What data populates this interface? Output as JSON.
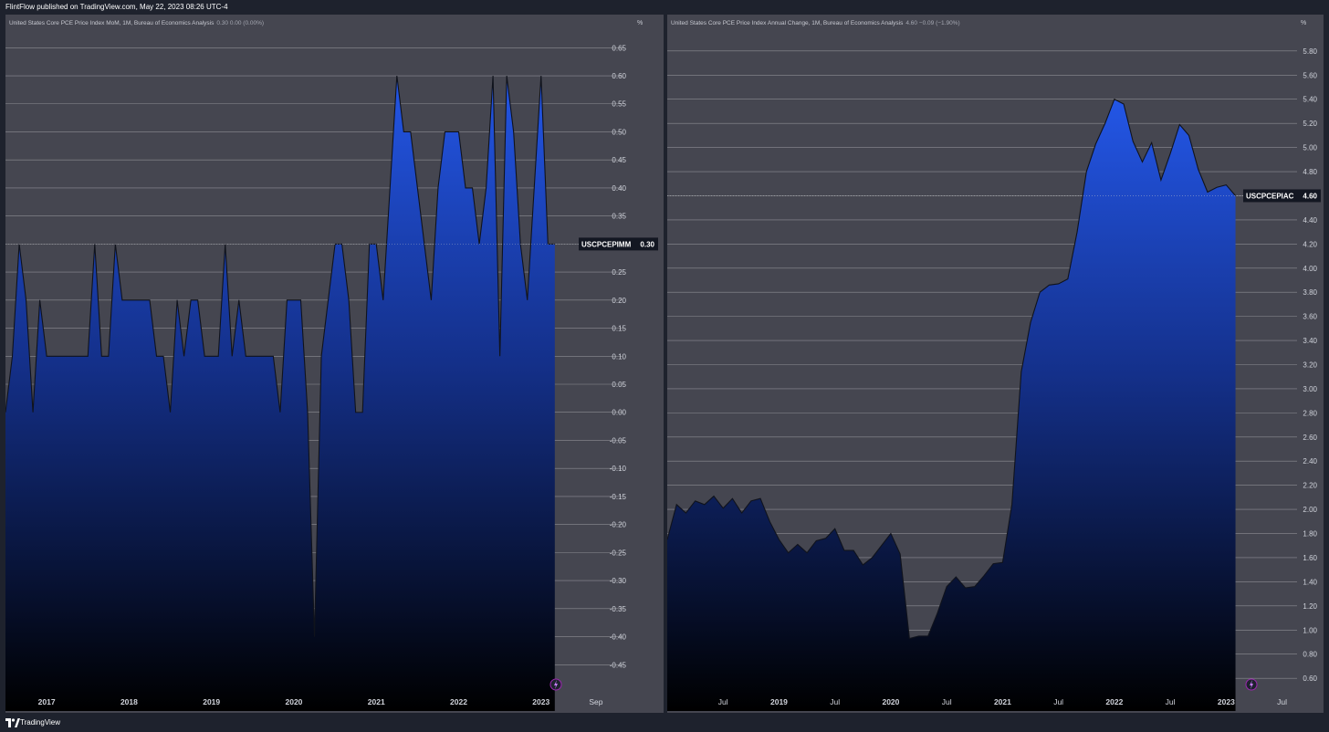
{
  "header": {
    "published": "FlintFlow published on TradingView.com, May 22, 2023 08:26 UTC-4"
  },
  "footer": {
    "brand": "TradingView"
  },
  "colors": {
    "panel_bg": "#454650",
    "page_bg": "#1e222d",
    "area_top": "#2356e6",
    "area_bottom": "#000000",
    "line": "#10131c",
    "grid": "#c8c9cc"
  },
  "icons": {
    "lightning": "lightning-icon",
    "logo": "tradingview-logo-icon"
  },
  "unit": "%",
  "chart_data": [
    {
      "type": "area",
      "legend": "United States Core PCE Price Index MoM, 1M, Bureau of Economics Analysis",
      "legend_values": "0.30  0.00 (0.00%)",
      "symbol": "USCPCEPIMM",
      "last_value_label": "0.30",
      "last_value": 0.3,
      "ylim": [
        -0.5,
        0.67
      ],
      "yticks": [
        0.65,
        0.6,
        0.55,
        0.5,
        0.45,
        0.4,
        0.35,
        0.3,
        0.25,
        0.2,
        0.15,
        0.1,
        0.05,
        0.0,
        -0.05,
        -0.1,
        -0.15,
        -0.2,
        -0.25,
        -0.3,
        -0.35,
        -0.4,
        -0.45
      ],
      "ytick_labels": [
        "0.65",
        "0.60",
        "0.55",
        "0.50",
        "0.45",
        "0.40",
        "0.35",
        "0.30",
        "0.25",
        "0.20",
        "0.15",
        "0.10",
        "0.05",
        "0.00",
        "-0.05",
        "-0.10",
        "-0.15",
        "-0.20",
        "-0.25",
        "-0.30",
        "-0.35",
        "-0.40",
        "-0.45"
      ],
      "x_start": "2016-07",
      "x_end": "2023-11",
      "xticks": [
        {
          "label": "2017",
          "date": "2017-01",
          "bold": true
        },
        {
          "label": "2018",
          "date": "2018-01",
          "bold": true
        },
        {
          "label": "2019",
          "date": "2019-01",
          "bold": true
        },
        {
          "label": "2020",
          "date": "2020-01",
          "bold": true
        },
        {
          "label": "2021",
          "date": "2021-01",
          "bold": true
        },
        {
          "label": "2022",
          "date": "2022-01",
          "bold": true
        },
        {
          "label": "2023",
          "date": "2023-01",
          "bold": true
        },
        {
          "label": "Sep",
          "date": "2023-09",
          "bold": false
        }
      ],
      "points": [
        {
          "x": "2016-07",
          "y": 0.0
        },
        {
          "x": "2016-08",
          "y": 0.1
        },
        {
          "x": "2016-09",
          "y": 0.3
        },
        {
          "x": "2016-10",
          "y": 0.2
        },
        {
          "x": "2016-11",
          "y": 0.0
        },
        {
          "x": "2016-12",
          "y": 0.2
        },
        {
          "x": "2017-01",
          "y": 0.1
        },
        {
          "x": "2017-02",
          "y": 0.1
        },
        {
          "x": "2017-03",
          "y": 0.1
        },
        {
          "x": "2017-04",
          "y": 0.1
        },
        {
          "x": "2017-05",
          "y": 0.1
        },
        {
          "x": "2017-06",
          "y": 0.1
        },
        {
          "x": "2017-07",
          "y": 0.1
        },
        {
          "x": "2017-08",
          "y": 0.3
        },
        {
          "x": "2017-09",
          "y": 0.1
        },
        {
          "x": "2017-10",
          "y": 0.1
        },
        {
          "x": "2017-11",
          "y": 0.3
        },
        {
          "x": "2017-12",
          "y": 0.2
        },
        {
          "x": "2018-01",
          "y": 0.2
        },
        {
          "x": "2018-02",
          "y": 0.2
        },
        {
          "x": "2018-03",
          "y": 0.2
        },
        {
          "x": "2018-04",
          "y": 0.2
        },
        {
          "x": "2018-05",
          "y": 0.1
        },
        {
          "x": "2018-06",
          "y": 0.1
        },
        {
          "x": "2018-07",
          "y": 0.0
        },
        {
          "x": "2018-08",
          "y": 0.2
        },
        {
          "x": "2018-09",
          "y": 0.1
        },
        {
          "x": "2018-10",
          "y": 0.2
        },
        {
          "x": "2018-11",
          "y": 0.2
        },
        {
          "x": "2018-12",
          "y": 0.1
        },
        {
          "x": "2019-01",
          "y": 0.1
        },
        {
          "x": "2019-02",
          "y": 0.1
        },
        {
          "x": "2019-03",
          "y": 0.3
        },
        {
          "x": "2019-04",
          "y": 0.1
        },
        {
          "x": "2019-05",
          "y": 0.2
        },
        {
          "x": "2019-06",
          "y": 0.1
        },
        {
          "x": "2019-07",
          "y": 0.1
        },
        {
          "x": "2019-08",
          "y": 0.1
        },
        {
          "x": "2019-09",
          "y": 0.1
        },
        {
          "x": "2019-10",
          "y": 0.1
        },
        {
          "x": "2019-11",
          "y": 0.0
        },
        {
          "x": "2019-12",
          "y": 0.2
        },
        {
          "x": "2020-01",
          "y": 0.2
        },
        {
          "x": "2020-02",
          "y": 0.2
        },
        {
          "x": "2020-03",
          "y": 0.0
        },
        {
          "x": "2020-04",
          "y": -0.4
        },
        {
          "x": "2020-05",
          "y": 0.1
        },
        {
          "x": "2020-06",
          "y": 0.2
        },
        {
          "x": "2020-07",
          "y": 0.3
        },
        {
          "x": "2020-08",
          "y": 0.3
        },
        {
          "x": "2020-09",
          "y": 0.2
        },
        {
          "x": "2020-10",
          "y": 0.0
        },
        {
          "x": "2020-11",
          "y": 0.0
        },
        {
          "x": "2020-12",
          "y": 0.3
        },
        {
          "x": "2021-01",
          "y": 0.3
        },
        {
          "x": "2021-02",
          "y": 0.2
        },
        {
          "x": "2021-03",
          "y": 0.4
        },
        {
          "x": "2021-04",
          "y": 0.6
        },
        {
          "x": "2021-05",
          "y": 0.5
        },
        {
          "x": "2021-06",
          "y": 0.5
        },
        {
          "x": "2021-07",
          "y": 0.4
        },
        {
          "x": "2021-08",
          "y": 0.3
        },
        {
          "x": "2021-09",
          "y": 0.2
        },
        {
          "x": "2021-10",
          "y": 0.4
        },
        {
          "x": "2021-11",
          "y": 0.5
        },
        {
          "x": "2021-12",
          "y": 0.5
        },
        {
          "x": "2022-01",
          "y": 0.5
        },
        {
          "x": "2022-02",
          "y": 0.4
        },
        {
          "x": "2022-03",
          "y": 0.4
        },
        {
          "x": "2022-04",
          "y": 0.3
        },
        {
          "x": "2022-05",
          "y": 0.4
        },
        {
          "x": "2022-06",
          "y": 0.6
        },
        {
          "x": "2022-07",
          "y": 0.1
        },
        {
          "x": "2022-08",
          "y": 0.6
        },
        {
          "x": "2022-09",
          "y": 0.5
        },
        {
          "x": "2022-10",
          "y": 0.3
        },
        {
          "x": "2022-11",
          "y": 0.2
        },
        {
          "x": "2022-12",
          "y": 0.4
        },
        {
          "x": "2023-01",
          "y": 0.6
        },
        {
          "x": "2023-02",
          "y": 0.3
        },
        {
          "x": "2023-03",
          "y": 0.3
        }
      ]
    },
    {
      "type": "area",
      "legend": "United States Core PCE Price Index Annual Change, 1M, Bureau of Economics Analysis",
      "legend_values": "4.60  −0.09 (−1.90%)",
      "symbol": "USCPCEPIAC",
      "last_value_label": "4.60",
      "last_value": 4.6,
      "ylim": [
        0.48,
        5.92
      ],
      "yticks": [
        5.8,
        5.6,
        5.4,
        5.2,
        5.0,
        4.8,
        4.6,
        4.4,
        4.2,
        4.0,
        3.8,
        3.6,
        3.4,
        3.2,
        3.0,
        2.8,
        2.6,
        2.4,
        2.2,
        2.0,
        1.8,
        1.6,
        1.4,
        1.2,
        1.0,
        0.8,
        0.6
      ],
      "ytick_labels": [
        "5.80",
        "5.60",
        "5.40",
        "5.20",
        "5.00",
        "4.80",
        "4.60",
        "4.40",
        "4.20",
        "4.00",
        "3.80",
        "3.60",
        "3.40",
        "3.20",
        "3.00",
        "2.80",
        "2.60",
        "2.40",
        "2.20",
        "2.00",
        "1.80",
        "1.60",
        "1.40",
        "1.20",
        "1.00",
        "0.80",
        "0.60"
      ],
      "x_start": "2018-01",
      "x_end": "2023-09",
      "xticks": [
        {
          "label": "Jul",
          "date": "2018-07",
          "bold": false
        },
        {
          "label": "2019",
          "date": "2019-01",
          "bold": true
        },
        {
          "label": "Jul",
          "date": "2019-07",
          "bold": false
        },
        {
          "label": "2020",
          "date": "2020-01",
          "bold": true
        },
        {
          "label": "Jul",
          "date": "2020-07",
          "bold": false
        },
        {
          "label": "2021",
          "date": "2021-01",
          "bold": true
        },
        {
          "label": "Jul",
          "date": "2021-07",
          "bold": false
        },
        {
          "label": "2022",
          "date": "2022-01",
          "bold": true
        },
        {
          "label": "Jul",
          "date": "2022-07",
          "bold": false
        },
        {
          "label": "2023",
          "date": "2023-01",
          "bold": true
        },
        {
          "label": "Jul",
          "date": "2023-07",
          "bold": false
        }
      ],
      "points": [
        {
          "x": "2018-01",
          "y": 1.75
        },
        {
          "x": "2018-02",
          "y": 2.04
        },
        {
          "x": "2018-03",
          "y": 1.97
        },
        {
          "x": "2018-04",
          "y": 2.07
        },
        {
          "x": "2018-05",
          "y": 2.04
        },
        {
          "x": "2018-06",
          "y": 2.11
        },
        {
          "x": "2018-07",
          "y": 2.01
        },
        {
          "x": "2018-08",
          "y": 2.09
        },
        {
          "x": "2018-09",
          "y": 1.97
        },
        {
          "x": "2018-10",
          "y": 2.07
        },
        {
          "x": "2018-11",
          "y": 2.09
        },
        {
          "x": "2018-12",
          "y": 1.9
        },
        {
          "x": "2019-01",
          "y": 1.75
        },
        {
          "x": "2019-02",
          "y": 1.64
        },
        {
          "x": "2019-03",
          "y": 1.71
        },
        {
          "x": "2019-04",
          "y": 1.64
        },
        {
          "x": "2019-05",
          "y": 1.74
        },
        {
          "x": "2019-06",
          "y": 1.76
        },
        {
          "x": "2019-07",
          "y": 1.84
        },
        {
          "x": "2019-08",
          "y": 1.66
        },
        {
          "x": "2019-09",
          "y": 1.66
        },
        {
          "x": "2019-10",
          "y": 1.54
        },
        {
          "x": "2019-11",
          "y": 1.6
        },
        {
          "x": "2019-12",
          "y": 1.7
        },
        {
          "x": "2020-01",
          "y": 1.8
        },
        {
          "x": "2020-02",
          "y": 1.63
        },
        {
          "x": "2020-03",
          "y": 0.93
        },
        {
          "x": "2020-04",
          "y": 0.95
        },
        {
          "x": "2020-05",
          "y": 0.95
        },
        {
          "x": "2020-06",
          "y": 1.14
        },
        {
          "x": "2020-07",
          "y": 1.36
        },
        {
          "x": "2020-08",
          "y": 1.44
        },
        {
          "x": "2020-09",
          "y": 1.35
        },
        {
          "x": "2020-10",
          "y": 1.36
        },
        {
          "x": "2020-11",
          "y": 1.45
        },
        {
          "x": "2020-12",
          "y": 1.55
        },
        {
          "x": "2021-01",
          "y": 1.56
        },
        {
          "x": "2021-02",
          "y": 2.04
        },
        {
          "x": "2021-03",
          "y": 3.14
        },
        {
          "x": "2021-04",
          "y": 3.55
        },
        {
          "x": "2021-05",
          "y": 3.8
        },
        {
          "x": "2021-06",
          "y": 3.86
        },
        {
          "x": "2021-07",
          "y": 3.87
        },
        {
          "x": "2021-08",
          "y": 3.91
        },
        {
          "x": "2021-09",
          "y": 4.3
        },
        {
          "x": "2021-10",
          "y": 4.8
        },
        {
          "x": "2021-11",
          "y": 5.03
        },
        {
          "x": "2021-12",
          "y": 5.2
        },
        {
          "x": "2022-01",
          "y": 5.4
        },
        {
          "x": "2022-02",
          "y": 5.36
        },
        {
          "x": "2022-03",
          "y": 5.05
        },
        {
          "x": "2022-04",
          "y": 4.88
        },
        {
          "x": "2022-05",
          "y": 5.04
        },
        {
          "x": "2022-06",
          "y": 4.73
        },
        {
          "x": "2022-07",
          "y": 4.95
        },
        {
          "x": "2022-08",
          "y": 5.19
        },
        {
          "x": "2022-09",
          "y": 5.1
        },
        {
          "x": "2022-10",
          "y": 4.82
        },
        {
          "x": "2022-11",
          "y": 4.63
        },
        {
          "x": "2022-12",
          "y": 4.67
        },
        {
          "x": "2023-01",
          "y": 4.69
        },
        {
          "x": "2023-02",
          "y": 4.6
        }
      ]
    }
  ]
}
